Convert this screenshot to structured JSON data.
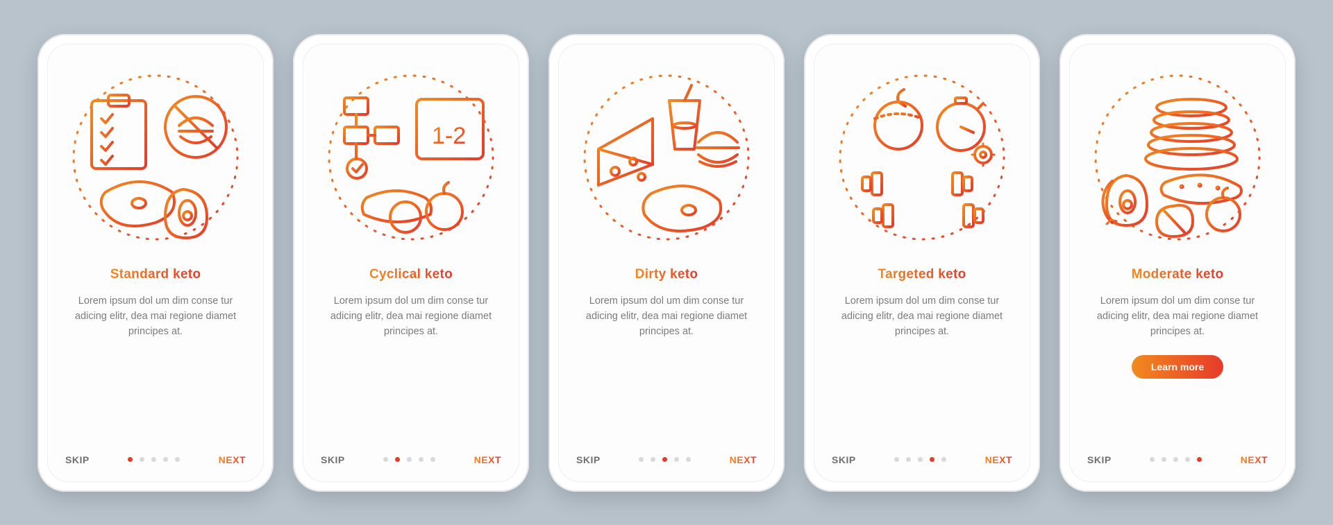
{
  "colors": {
    "gradient_start": "#f28a1f",
    "gradient_end": "#e63a2a",
    "muted": "#7b7b7b"
  },
  "shared": {
    "skip_label": "SKIP",
    "next_label": "NEXT",
    "description": "Lorem ipsum dol um dim conse tur adicing elitr, dea mai regione diamet principes at."
  },
  "cta_label": "Learn more",
  "screens": [
    {
      "title": "Standard keto",
      "active_dot": 0,
      "has_cta": false,
      "illustration": "standard-keto-illustration"
    },
    {
      "title": "Cyclical keto",
      "active_dot": 1,
      "has_cta": false,
      "illustration": "cyclical-keto-illustration"
    },
    {
      "title": "Dirty keto",
      "active_dot": 2,
      "has_cta": false,
      "illustration": "dirty-keto-illustration"
    },
    {
      "title": "Targeted keto",
      "active_dot": 3,
      "has_cta": false,
      "illustration": "targeted-keto-illustration"
    },
    {
      "title": "Moderate keto",
      "active_dot": 4,
      "has_cta": true,
      "illustration": "moderate-keto-illustration"
    }
  ]
}
